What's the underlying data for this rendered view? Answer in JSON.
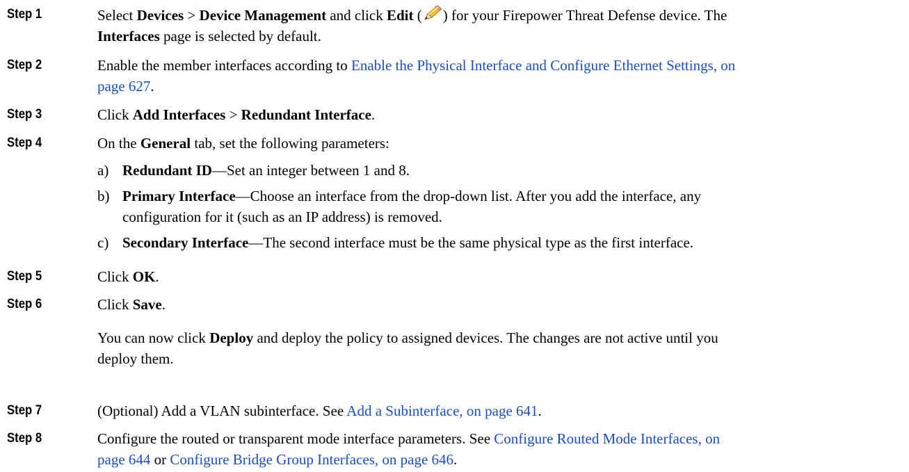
{
  "steps": [
    {
      "label": "Step 1",
      "t1": "Select ",
      "b1": "Devices",
      "t2": " > ",
      "b2": "Device Management",
      "t3": " and click ",
      "b3": "Edit",
      "t4": " (",
      "icon": "pencil-icon",
      "t5": ") for your Firepower Threat Defense device. The",
      "b4": "Interfaces",
      "t6": " page is selected by default."
    },
    {
      "label": "Step 2",
      "t1": "Enable the member interfaces according to ",
      "link1": "Enable the Physical Interface and Configure Ethernet Settings, on",
      "link2": "page 627",
      "t2": "."
    },
    {
      "label": "Step 3",
      "t1": "Click ",
      "b1": "Add Interfaces",
      "t2": " > ",
      "b2": "Redundant Interface",
      "t3": "."
    },
    {
      "label": "Step 4",
      "t1": "On the ",
      "b1": "General",
      "t2": " tab, set the following parameters:",
      "subs": [
        {
          "marker": "a)",
          "b": "Redundant ID",
          "t": "—Set an integer between 1 and 8."
        },
        {
          "marker": "b)",
          "b": "Primary Interface",
          "t": "—Choose an interface from the drop-down list. After you add the interface, any",
          "t2": "configuration for it (such as an IP address) is removed."
        },
        {
          "marker": "c)",
          "b": "Secondary Interface",
          "t": "—The second interface must be the same physical type as the first interface."
        }
      ]
    },
    {
      "label": "Step 5",
      "t1": "Click ",
      "b1": "OK",
      "t2": "."
    },
    {
      "label": "Step 6",
      "t1": "Click ",
      "b1": "Save",
      "t2": ".",
      "note_t1": "You can now click ",
      "note_b1": "Deploy",
      "note_t2": " and deploy the policy to assigned devices. The changes are not active until you",
      "note_t3": "deploy them."
    },
    {
      "label": "Step 7",
      "t1": "(Optional) Add a VLAN subinterface. See ",
      "link1": "Add a Subinterface, on page 641",
      "t2": "."
    },
    {
      "label": "Step 8",
      "t1": "Configure the routed or transparent mode interface parameters. See ",
      "link1": "Configure Routed Mode Interfaces, on",
      "link2": "page 644",
      "t2": " or ",
      "link3": "Configure Bridge Group Interfaces, on page 646",
      "t3": "."
    }
  ],
  "colors": {
    "link": "#1a4fc4",
    "text": "#000000"
  }
}
